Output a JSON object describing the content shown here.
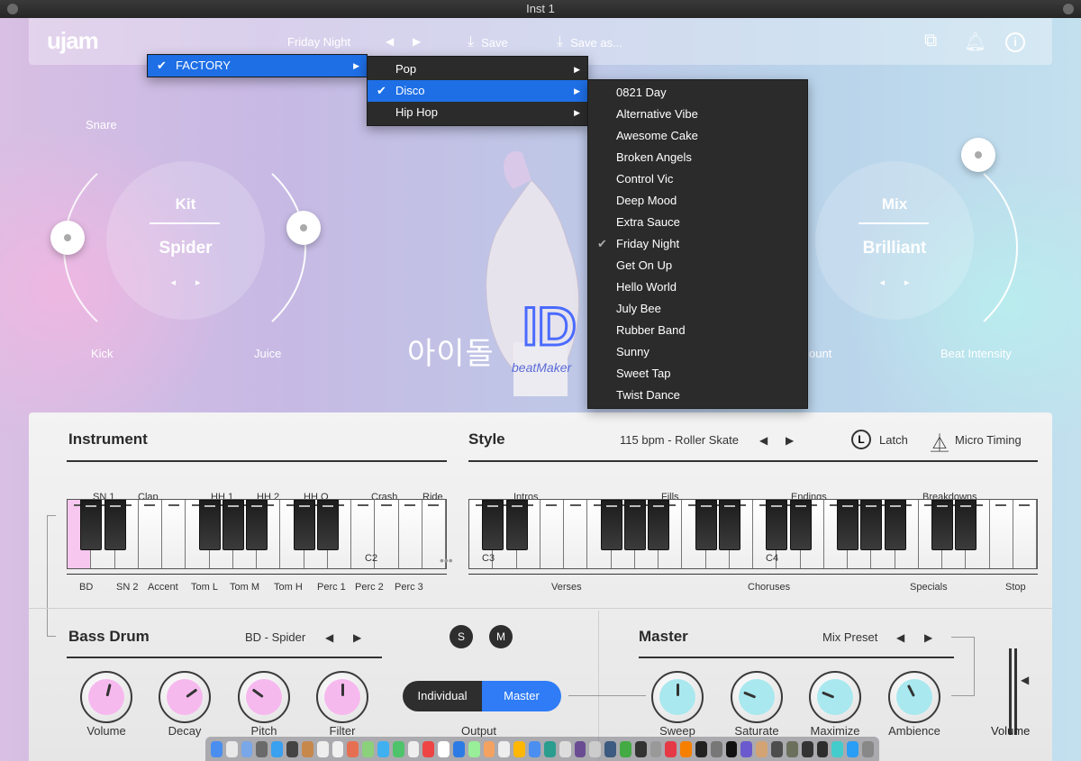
{
  "window": {
    "title": "Inst 1"
  },
  "topbar": {
    "logo": "ujam",
    "preset": "Friday Night",
    "save_label": "Save",
    "save_as_label": "Save as..."
  },
  "menus": {
    "level1": [
      {
        "label": "FACTORY",
        "checked": true,
        "submenu": true
      }
    ],
    "level2": [
      {
        "label": "Pop",
        "submenu": true
      },
      {
        "label": "Disco",
        "checked": true,
        "submenu": true
      },
      {
        "label": "Hip Hop",
        "submenu": true
      }
    ],
    "level3": [
      "0821 Day",
      "Alternative Vibe",
      "Awesome Cake",
      "Broken Angels",
      "Control Vic",
      "Deep Mood",
      "Extra Sauce",
      "Friday Night",
      "Get On Up",
      "Hello World",
      "July Bee",
      "Rubber Band",
      "Sunny",
      "Sweet Tap",
      "Twist Dance"
    ],
    "level3_checked": "Friday Night"
  },
  "kit": {
    "title": "Kit",
    "value": "Spider",
    "snare": "Snare",
    "kick": "Kick",
    "juice": "Juice"
  },
  "mix": {
    "title": "Mix",
    "value": "Brilliant",
    "left_label": "ount",
    "right_label": "Beat Intensity"
  },
  "art": {
    "korean": "아이돌",
    "id": "ID",
    "brand": "beatMaker"
  },
  "instrument": {
    "title": "Instrument",
    "top_labels": [
      "SN 1",
      "Clap",
      "HH 1",
      "HH 2",
      "HH O",
      "Crash",
      "Ride"
    ],
    "bottom_labels": [
      "BD",
      "SN 2",
      "Accent",
      "Tom L",
      "Tom M",
      "Tom H",
      "Perc 1",
      "Perc 2",
      "Perc 3"
    ],
    "octave_label": "C2"
  },
  "style": {
    "title": "Style",
    "value": "115 bpm - Roller Skate",
    "latch": "Latch",
    "micro_timing": "Micro Timing",
    "top_labels": [
      "Intros",
      "Fills",
      "Endings",
      "Breakdowns"
    ],
    "bottom_labels": [
      "Verses",
      "Choruses",
      "Specials",
      "Stop"
    ],
    "octave_labels": [
      "C3",
      "C4"
    ]
  },
  "bass_drum": {
    "title": "Bass Drum",
    "preset": "BD - Spider",
    "solo": "S",
    "mute": "M",
    "knobs": [
      {
        "label": "Volume",
        "level": 0.55
      },
      {
        "label": "Decay",
        "level": 0.7
      },
      {
        "label": "Pitch",
        "level": 0.3
      },
      {
        "label": "Filter",
        "level": 0.5
      }
    ],
    "knob_color": "#f6b9ee"
  },
  "output": {
    "label": "Output",
    "individual": "Individual",
    "master": "Master",
    "active": "Master",
    "accent": "#2f7cf6"
  },
  "master": {
    "title": "Master",
    "preset": "Mix Preset",
    "knobs": [
      {
        "label": "Sweep",
        "level": 0.5
      },
      {
        "label": "Saturate",
        "level": 0.25
      },
      {
        "label": "Maximize",
        "level": 0.25
      },
      {
        "label": "Ambience",
        "level": 0.4
      }
    ],
    "knob_color": "#a9e8ee",
    "volume_label": "Volume"
  }
}
